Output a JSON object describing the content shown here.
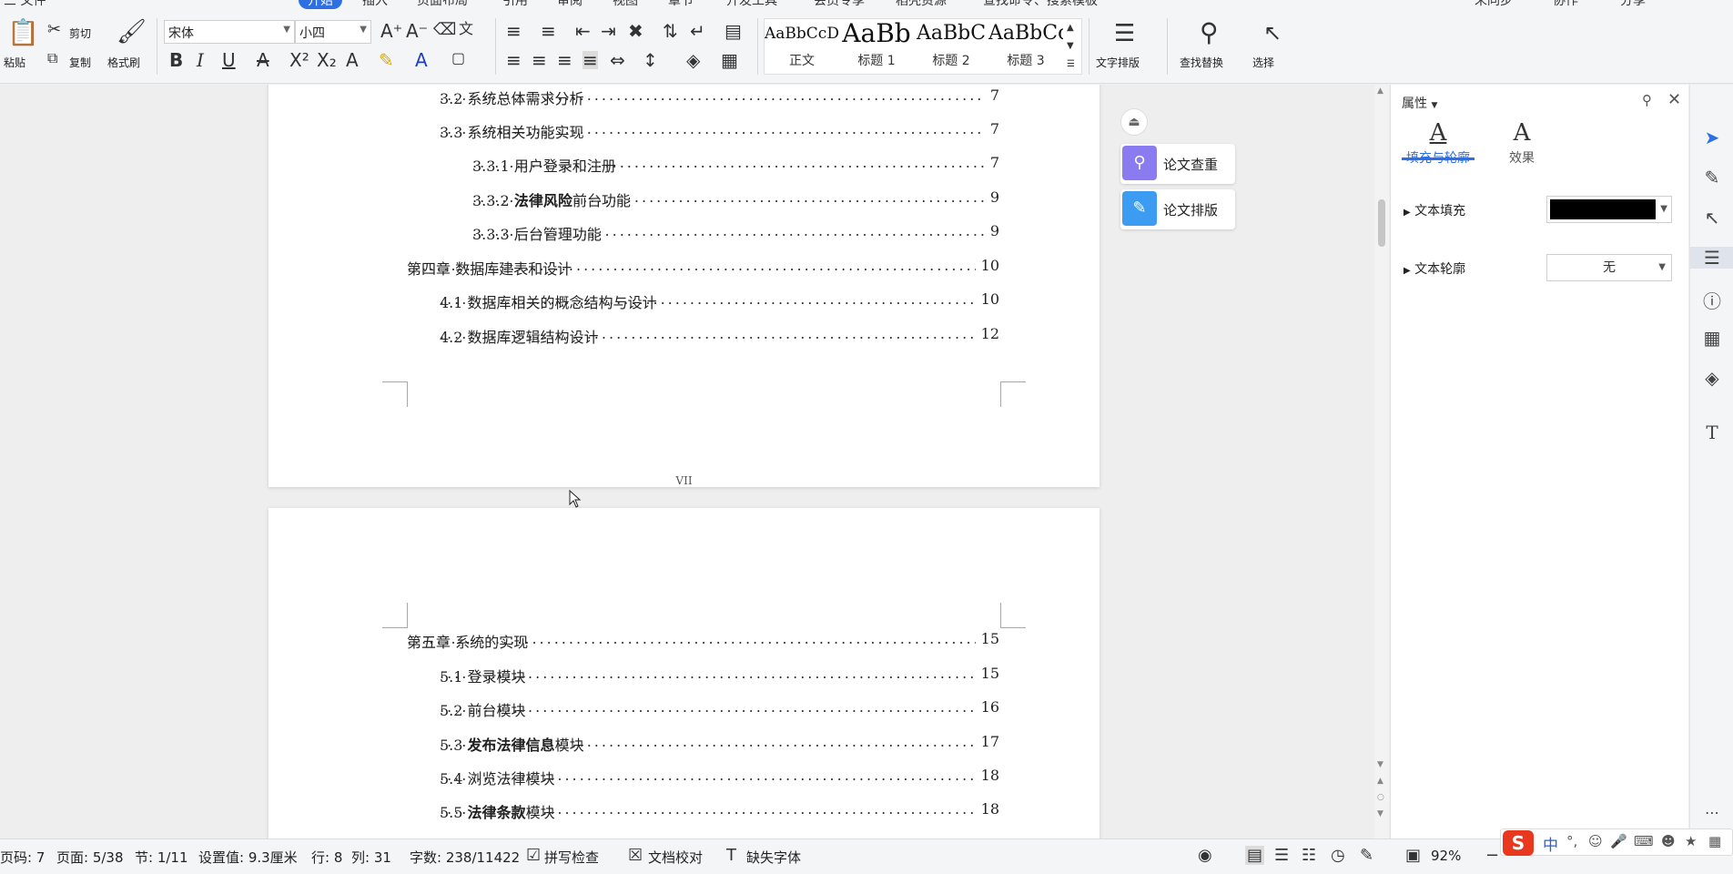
{
  "ribbon": {
    "tabs": [
      "三 文件",
      "开始",
      "插入",
      "页面布局",
      "引用",
      "审阅",
      "视图",
      "章节",
      "开发工具",
      "会员专享",
      "稻壳资源",
      "查找命令、搜索模板"
    ],
    "top_right": [
      "未同步",
      "协作",
      "分享"
    ],
    "clipboard": {
      "paste": "粘贴",
      "cut": "剪切",
      "copy": "复制",
      "format_painter": "格式刷"
    },
    "font": {
      "family": "宋体",
      "size": "小四"
    },
    "styles": [
      {
        "preview": "AaBbCcDd",
        "label": "正文"
      },
      {
        "preview": "AaBb",
        "label": "标题 1"
      },
      {
        "preview": "AaBbC",
        "label": "标题 2"
      },
      {
        "preview": "AaBbCc",
        "label": "标题 3"
      }
    ],
    "text_layout": "文字排版",
    "find_replace": "查找替换",
    "select": "选择"
  },
  "document": {
    "page1_toc": [
      {
        "text": "3.2 系统总体需求分析",
        "page": "7",
        "level": 1
      },
      {
        "text": "3.3 系统相关功能实现",
        "page": "7",
        "level": 1
      },
      {
        "text": "3.3.1 用户登录和注册",
        "page": "7",
        "level": 2
      },
      {
        "num": "3.3.2",
        "bold": "法律风险",
        "rest": "前台功能",
        "page": "9",
        "level": 2
      },
      {
        "text": "3.3.3 后台管理功能",
        "page": "9",
        "level": 2
      },
      {
        "text": "第四章 数据库建表和设计",
        "page": "10",
        "level": 0
      },
      {
        "text": "4.1 数据库相关的概念结构与设计",
        "page": "10",
        "level": 1
      },
      {
        "text": "4.2 数据库逻辑结构设计",
        "page": "12",
        "level": 1
      }
    ],
    "page1_number": "VII",
    "page2_toc": [
      {
        "text": "第五章 系统的实现",
        "page": "15",
        "level": 0
      },
      {
        "text": "5.1 登录模块",
        "page": "15",
        "level": 1
      },
      {
        "text": "5.2 前台模块",
        "page": "16",
        "level": 1
      },
      {
        "num": "5.3",
        "bold": "发布法律信息",
        "rest": "模块",
        "page": "17",
        "level": 1
      },
      {
        "text": "5.4 浏览法律模块",
        "page": "18",
        "level": 1
      },
      {
        "num": "5.5",
        "bold": "法律条款",
        "rest": "模块",
        "page": "18",
        "level": 1
      }
    ]
  },
  "floating": {
    "plagiarism_check": "论文查重",
    "thesis_format": "论文排版"
  },
  "properties": {
    "header": "属性",
    "tabs": [
      "填充与轮廓",
      "效果"
    ],
    "text_fill_label": "文本填充",
    "text_fill_color": "#000000",
    "text_outline_label": "文本轮廓",
    "text_outline_value": "无"
  },
  "status": {
    "page_code": "页码: 7",
    "page": "页面: 5/38",
    "section": "节: 1/11",
    "position": "设置值: 9.3厘米",
    "row": "行: 8",
    "col": "列: 31",
    "word_count": "字数: 238/11422",
    "spell_check": "拼写检查",
    "doc_proofread": "文档校对",
    "missing_font": "缺失字体",
    "zoom": "92%"
  },
  "ime": {
    "lang": "中"
  },
  "colors": {
    "accent": "#2f6fe4",
    "ime_logo": "#e8381e"
  }
}
